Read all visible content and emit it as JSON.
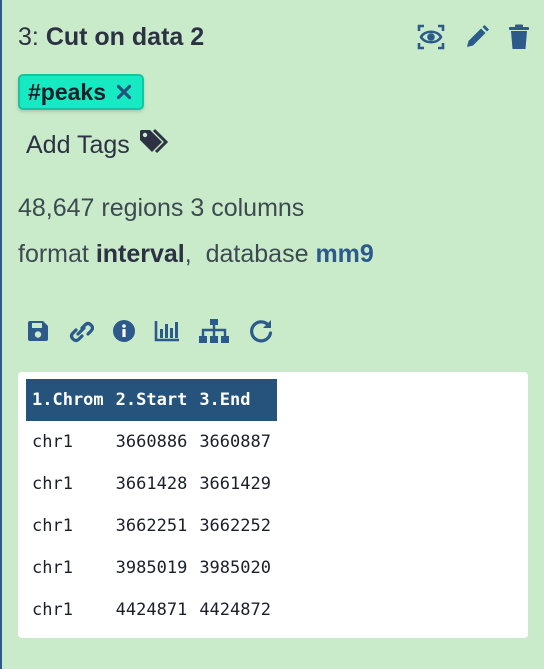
{
  "dataset": {
    "hid": "3:",
    "name": "Cut on data 2"
  },
  "title_icons": [
    "eye-icon",
    "pencil-icon",
    "trash-icon"
  ],
  "tags": [
    {
      "label": "#peaks"
    }
  ],
  "add_tags_label": "Add Tags",
  "summary": {
    "regions": "48,647 regions 3 columns"
  },
  "format": {
    "format_prefix": "format",
    "format_value": "interval",
    "separator": ",",
    "database_prefix": "database",
    "database_value": "mm9"
  },
  "toolbar_icons": [
    "save-icon",
    "link-icon",
    "info-icon",
    "chart-icon",
    "sitemap-icon",
    "redo-icon"
  ],
  "peek": {
    "columns": [
      "1.Chrom",
      "2.Start",
      "3.End"
    ],
    "rows": [
      [
        "chr1",
        "3660886",
        "3660887"
      ],
      [
        "chr1",
        "3661428",
        "3661429"
      ],
      [
        "chr1",
        "3662251",
        "3662252"
      ],
      [
        "chr1",
        "3985019",
        "3985020"
      ],
      [
        "chr1",
        "4424871",
        "4424872"
      ]
    ]
  },
  "colors": {
    "background": "#c9ebca",
    "tag": "#17e9c3",
    "header": "#25537b",
    "link": "#2c5a8a"
  }
}
